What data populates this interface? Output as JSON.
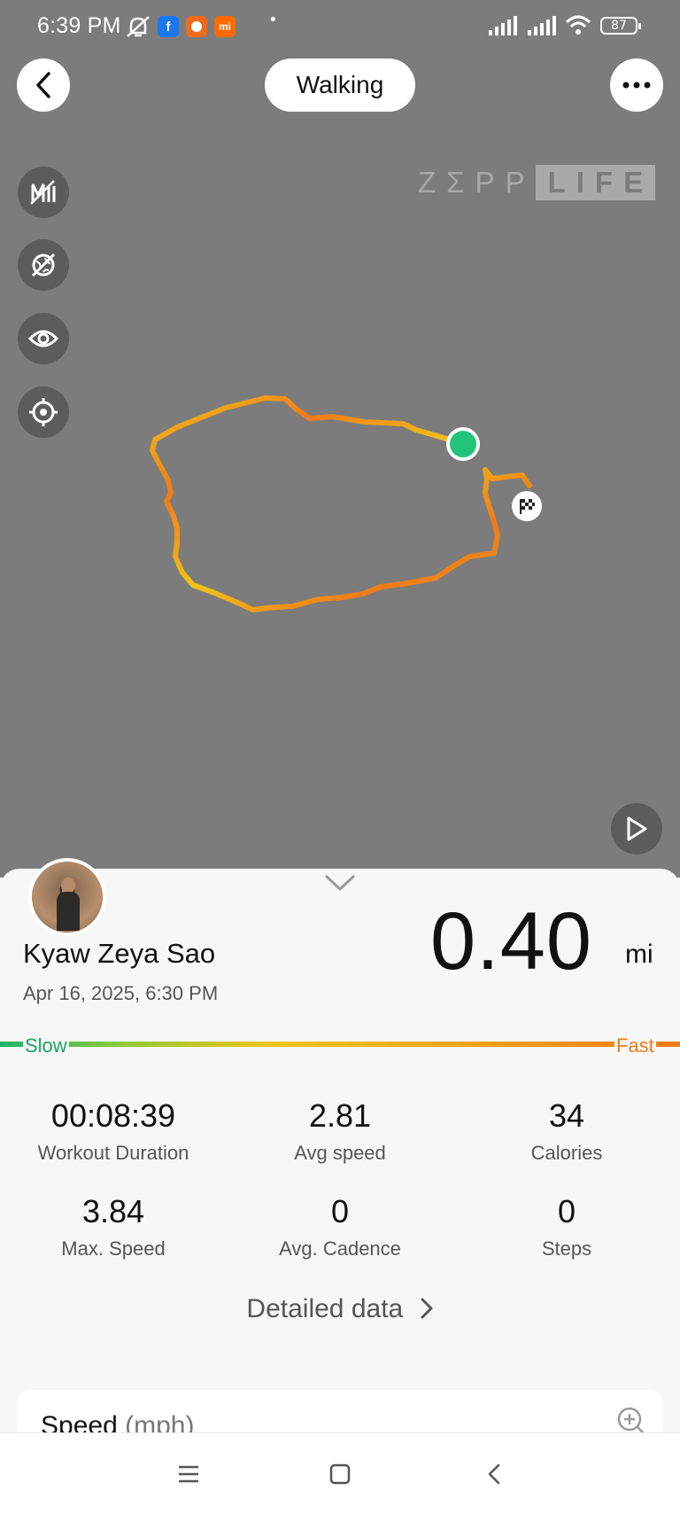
{
  "status_bar": {
    "time": "6:39 PM",
    "battery": "87",
    "apps": [
      {
        "name": "facebook",
        "glyph": "f",
        "color": "#1877f2"
      },
      {
        "name": "app-orange",
        "glyph": "",
        "color": "#f06a1a"
      },
      {
        "name": "xiaomi",
        "glyph": "mi",
        "color": "#ff6900"
      }
    ]
  },
  "header": {
    "activity_type": "Walking",
    "back_icon": "chevron-left-icon",
    "more_icon": "more-horizontal-icon"
  },
  "map": {
    "brand_zepp": "ZΣPP",
    "brand_life": "LIFE",
    "tools": [
      "mileage-icon",
      "satellite-off-icon",
      "eye-icon",
      "locate-icon"
    ],
    "start_marker_color": "#22c37a",
    "route_colors": [
      "#f07a18",
      "#f0c419"
    ]
  },
  "summary": {
    "user_name": "Kyaw Zeya Sao",
    "date_time": "Apr 16, 2025, 6:30 PM",
    "distance": "0.40",
    "distance_unit": "mi"
  },
  "pace_legend": {
    "slow": "Slow",
    "fast": "Fast"
  },
  "stats": [
    {
      "value": "00:08:39",
      "label": "Workout Duration"
    },
    {
      "value": "2.81",
      "label": "Avg speed"
    },
    {
      "value": "34",
      "label": "Calories"
    },
    {
      "value": "3.84",
      "label": "Max. Speed"
    },
    {
      "value": "0",
      "label": "Avg. Cadence"
    },
    {
      "value": "0",
      "label": "Steps"
    }
  ],
  "detailed_link": "Detailed data",
  "speed_card": {
    "title": "Speed",
    "unit": "(mph)"
  }
}
